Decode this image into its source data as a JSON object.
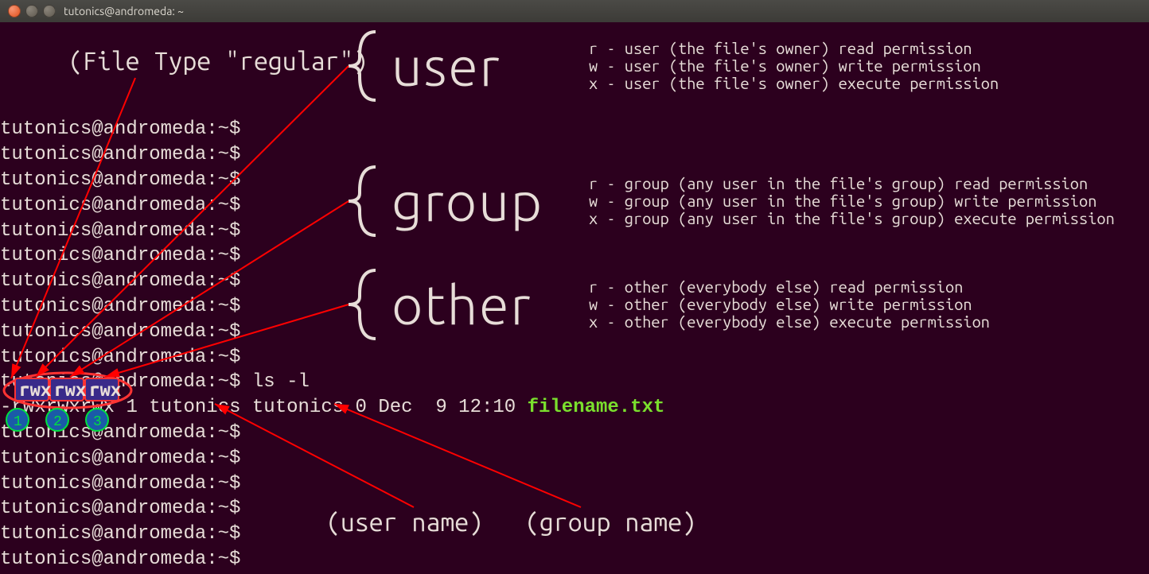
{
  "title": "tutonics@andromeda: ~",
  "filetype_label": "(File Type \"regular\")",
  "prompt": "tutonics@andromeda:~$",
  "command": "ls -l",
  "ls": {
    "type_char": "-",
    "perm_user": "rwx",
    "perm_group": "rwx",
    "perm_other": "rwx",
    "links": "1",
    "owner": "tutonics",
    "group": "tutonics",
    "size": "0",
    "date": "Dec  9 12:10",
    "filename": "filename.txt"
  },
  "annot_user_name": "(user name)",
  "annot_group_name": "(group name)",
  "categories": {
    "user": {
      "label": "user",
      "lines": [
        "r -  user (the file's owner) read permission",
        "w -  user (the file's owner) write permission",
        "x -  user (the file's owner) execute permission"
      ]
    },
    "group": {
      "label": "group",
      "lines": [
        "r -  group (any user in the file's group) read permission",
        "w -  group (any user in the file's group) write permission",
        "x -  group (any user in the file's group) execute permission"
      ]
    },
    "other": {
      "label": "other",
      "lines": [
        "r -  other (everybody else) read permission",
        "w -  other (everybody else) write permission",
        "x -  other (everybody else) execute permission"
      ]
    }
  },
  "circle_labels": [
    "1",
    "2",
    "3"
  ]
}
